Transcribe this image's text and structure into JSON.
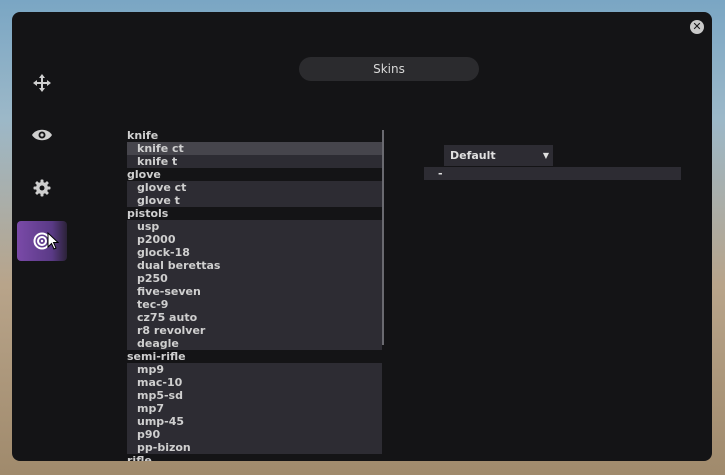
{
  "window": {
    "title": "Skins"
  },
  "sidebar": {
    "items": [
      {
        "name": "move-icon"
      },
      {
        "name": "eye-icon"
      },
      {
        "name": "gear-icon"
      },
      {
        "name": "skins-icon",
        "active": true
      }
    ]
  },
  "skin_list": {
    "groups": [
      {
        "label": "knife",
        "items": [
          "knife ct",
          "knife t"
        ]
      },
      {
        "label": "glove",
        "items": [
          "glove ct",
          "glove t"
        ]
      },
      {
        "label": "pistols",
        "items": [
          "usp",
          "p2000",
          "glock-18",
          "dual berettas",
          "p250",
          "five-seven",
          "tec-9",
          "cz75 auto",
          "r8 revolver",
          "deagle"
        ]
      },
      {
        "label": "semi-rifle",
        "items": [
          "mp9",
          "mac-10",
          "mp5-sd",
          "mp7",
          "ump-45",
          "p90",
          "pp-bizon"
        ]
      },
      {
        "label": "rifle",
        "items": []
      }
    ],
    "selected": "knife ct"
  },
  "skin_select": {
    "value": "Default"
  },
  "value_field": {
    "value": "-"
  },
  "colors": {
    "accent": "#7a4aa8",
    "panel": "#2d2c33",
    "window": "#141416"
  }
}
